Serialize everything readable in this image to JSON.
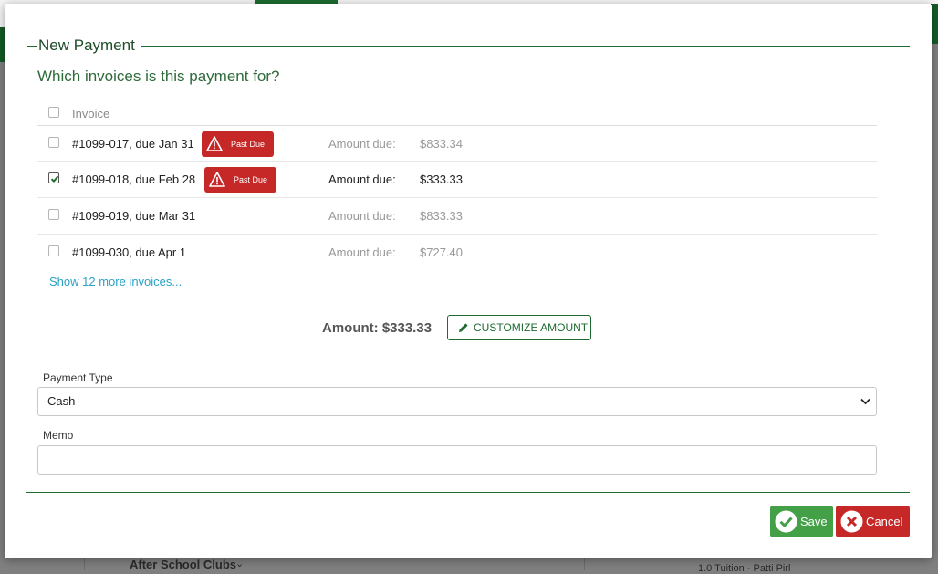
{
  "background": {
    "section_label": "After School Clubs",
    "misc_text": "1.0 Tuition · Patti Pirl"
  },
  "modal": {
    "title": "New Payment",
    "question": "Which invoices is this payment for?",
    "header_label": "Invoice",
    "invoices": [
      {
        "label": "#1099-017, due Jan 31",
        "past_due": true,
        "badge": "Past Due",
        "amount_label": "Amount due:",
        "amount": "$833.34",
        "checked": false
      },
      {
        "label": "#1099-018, due Feb 28",
        "past_due": true,
        "badge": "Past Due",
        "amount_label": "Amount due:",
        "amount": "$333.33",
        "checked": true
      },
      {
        "label": "#1099-019, due Mar 31",
        "past_due": false,
        "amount_label": "Amount due:",
        "amount": "$833.33",
        "checked": false
      },
      {
        "label": "#1099-030, due Apr 1",
        "past_due": false,
        "amount_label": "Amount due:",
        "amount": "$727.40",
        "checked": false
      }
    ],
    "show_more": "Show 12 more invoices...",
    "amount_text": "Amount: $333.33",
    "customize_label": "CUSTOMIZE AMOUNT",
    "payment_type_label": "Payment Type",
    "payment_type_value": "Cash",
    "memo_label": "Memo",
    "memo_value": "",
    "save_label": "Save",
    "cancel_label": "Cancel"
  },
  "colors": {
    "brand_green": "#1d6b30",
    "danger": "#c62828",
    "success": "#43a047",
    "link": "#2aa1c4"
  },
  "icons": [
    "warning-icon",
    "checkmark-icon",
    "pencil-icon",
    "chevron-down-icon",
    "check-circle-icon",
    "x-circle-icon"
  ]
}
